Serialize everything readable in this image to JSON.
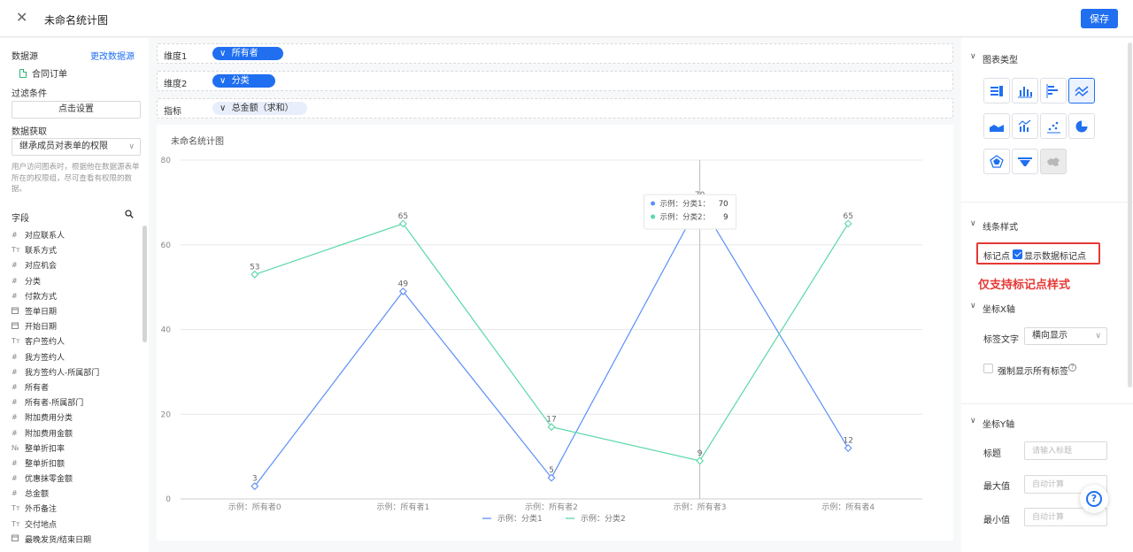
{
  "topbar": {
    "title": "未命名统计图",
    "save_label": "保存"
  },
  "left": {
    "datasource_label": "数据源",
    "change_datasource": "更改数据源",
    "datasource_item": "合同订单",
    "filter_label": "过滤条件",
    "filter_button": "点击设置",
    "fetch_label": "数据获取",
    "fetch_value": "继承成员对表单的权限",
    "fetch_hint": "用户访问图表时，根据他在数据源表单所在的权限组，尽可查看有权限的数据。",
    "fields_label": "字段",
    "fields": [
      {
        "icon": "#",
        "name": "对应联系人"
      },
      {
        "icon": "Tт",
        "name": "联系方式"
      },
      {
        "icon": "#",
        "name": "对应机会"
      },
      {
        "icon": "#",
        "name": "分类"
      },
      {
        "icon": "#",
        "name": "付款方式"
      },
      {
        "icon": "cal",
        "name": "签单日期"
      },
      {
        "icon": "cal",
        "name": "开始日期"
      },
      {
        "icon": "Tт",
        "name": "客户签约人"
      },
      {
        "icon": "#",
        "name": "我方签约人"
      },
      {
        "icon": "#",
        "name": "我方签约人-所属部门"
      },
      {
        "icon": "#",
        "name": "所有者"
      },
      {
        "icon": "#",
        "name": "所有者-所属部门"
      },
      {
        "icon": "#",
        "name": "附加费用分类"
      },
      {
        "icon": "#",
        "name": "附加费用金额"
      },
      {
        "icon": "№",
        "name": "整单折扣率"
      },
      {
        "icon": "#",
        "name": "整单折扣额"
      },
      {
        "icon": "#",
        "name": "优惠抹零金额"
      },
      {
        "icon": "#",
        "name": "总金额"
      },
      {
        "icon": "Tт",
        "name": "外币备注"
      },
      {
        "icon": "Tт",
        "name": "交付地点"
      },
      {
        "icon": "cal",
        "name": "最晚发货/结束日期"
      }
    ]
  },
  "center": {
    "dim1_label": "维度1",
    "dim1_value": "所有者",
    "dim2_label": "维度2",
    "dim2_value": "分类",
    "metric_label": "指标",
    "metric_value": "总金额（求和）",
    "chart_title": "未命名统计图"
  },
  "chart_data": {
    "type": "line",
    "categories": [
      "示例：所有者0",
      "示例：所有者1",
      "示例：所有者2",
      "示例：所有者3",
      "示例：所有者4"
    ],
    "series": [
      {
        "name": "示例：分类1",
        "values": [
          3,
          49,
          5,
          70,
          12
        ],
        "color": "#5b8ff9"
      },
      {
        "name": "示例：分类2",
        "values": [
          53,
          65,
          17,
          9,
          65
        ],
        "color": "#5ad8a6"
      }
    ],
    "ylim": [
      0,
      80
    ],
    "yticks": [
      "0",
      "20",
      "40",
      "60",
      "80"
    ],
    "grid": true,
    "legend": "bottom",
    "tooltip": {
      "category_index": 3,
      "rows": [
        {
          "label": "示例：分类1：",
          "value": "70"
        },
        {
          "label": "示例：分类2：",
          "value": "9"
        }
      ]
    }
  },
  "right": {
    "chart_type_label": "图表类型",
    "line_style_label": "线条样式",
    "marker_label": "标记点",
    "marker_checkbox": "显示数据标记点",
    "note": "仅支持标记点样式",
    "xaxis_label": "坐标X轴",
    "label_text": "标签文字",
    "label_text_value": "横向显示",
    "force_all_labels": "强制显示所有标签",
    "yaxis_label": "坐标Y轴",
    "title_label": "标题",
    "title_placeholder": "请输入标题",
    "max_label": "最大值",
    "max_placeholder": "自动计算",
    "min_label": "最小值",
    "min_placeholder": "自动计算"
  },
  "colors": {
    "accent": "#1f6ff0",
    "highlight": "#e53935"
  },
  "icons": {
    "help": "question-circle-icon",
    "close": "close-icon",
    "search": "search-icon"
  }
}
